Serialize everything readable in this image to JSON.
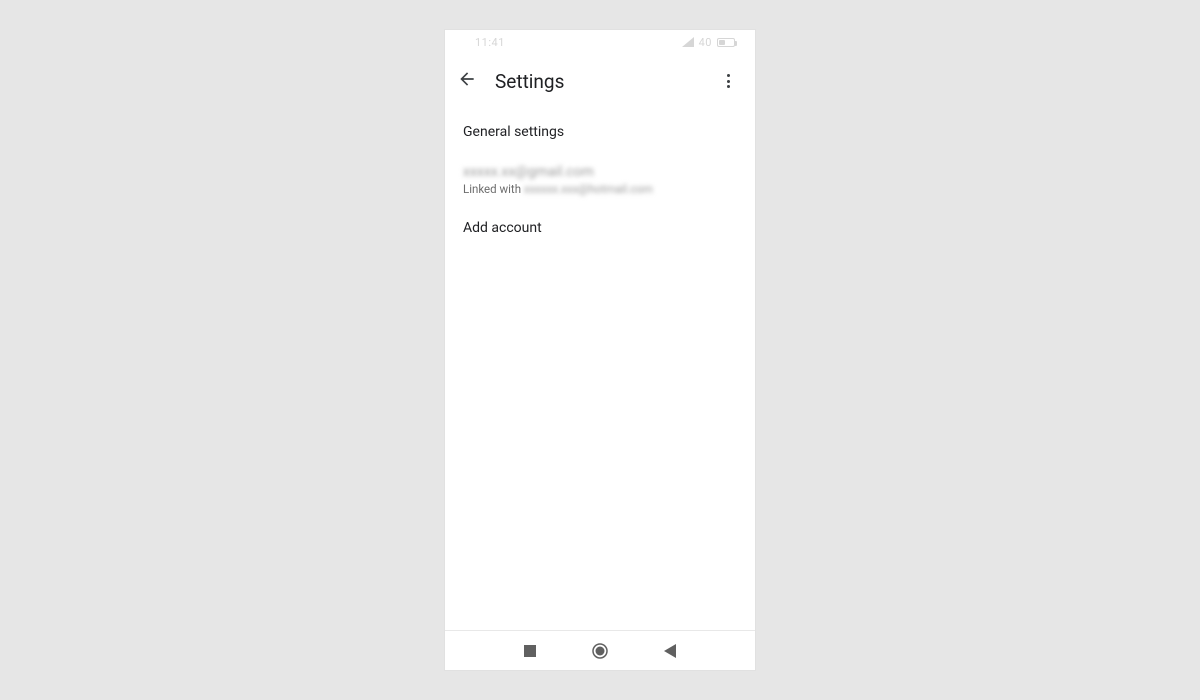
{
  "statusbar": {
    "time": "11:41",
    "battery_text": "40"
  },
  "appbar": {
    "title": "Settings"
  },
  "settings": {
    "general_label": "General settings",
    "account_email": "xxxxx.xx@gmail.com",
    "account_linked_prefix": "Linked with ",
    "account_linked_email": "xxxxxx.xxx@hotmail.com",
    "add_account": "Add account"
  }
}
